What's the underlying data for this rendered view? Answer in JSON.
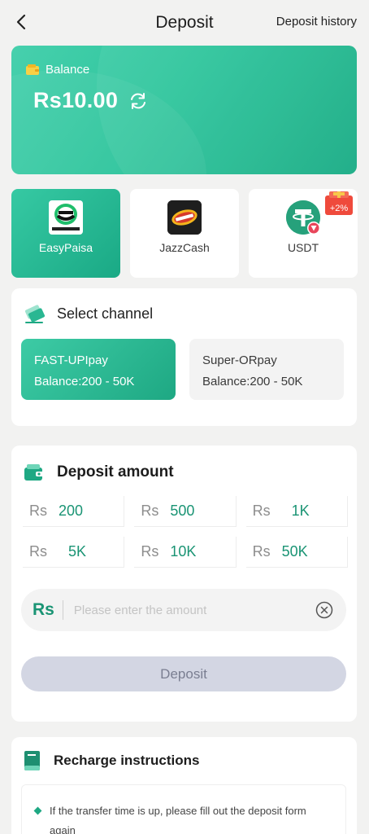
{
  "header": {
    "back_icon": "chevron-left-icon",
    "title": "Deposit",
    "history_label": "Deposit history"
  },
  "balance": {
    "label": "Balance",
    "amount": "Rs10.00",
    "wallet_icon": "wallet-icon",
    "refresh_icon": "refresh-icon"
  },
  "payment_methods": [
    {
      "label": "EasyPaisa",
      "selected": true
    },
    {
      "label": "JazzCash",
      "selected": false
    },
    {
      "label": "USDT",
      "selected": false,
      "badge": "+2%"
    }
  ],
  "channel": {
    "title": "Select channel",
    "options": [
      {
        "name": "FAST-UPIpay",
        "balance": "Balance:200 - 50K",
        "selected": true
      },
      {
        "name": "Super-ORpay",
        "balance": "Balance:200 - 50K",
        "selected": false
      }
    ]
  },
  "deposit_amount": {
    "title": "Deposit amount",
    "currency": "Rs",
    "presets": [
      "200",
      "500",
      "1K",
      "5K",
      "10K",
      "50K"
    ],
    "input_currency": "Rs",
    "input_placeholder": "Please enter the amount",
    "input_value": "",
    "button_label": "Deposit"
  },
  "instructions": {
    "title": "Recharge instructions",
    "items": [
      "If the transfer time is up, please fill out the deposit form again"
    ]
  },
  "colors": {
    "accent": "#1ea883",
    "accent_text": "#1a9474",
    "page_bg": "#f2f2f1",
    "disabled_button": "#d3d6e3"
  }
}
